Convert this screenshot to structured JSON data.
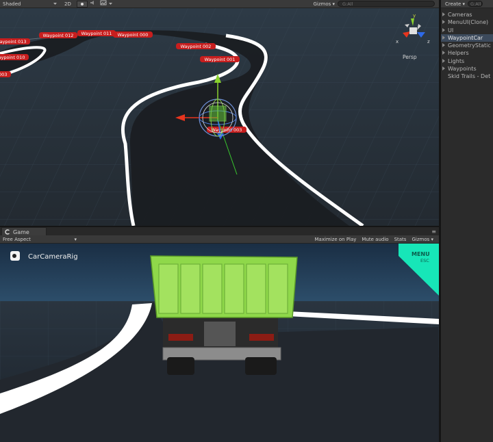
{
  "scene_toolbar": {
    "shading_mode": "Shaded",
    "mode_2d": "2D",
    "gizmos": "Gizmos",
    "search_placeholder": "G:All"
  },
  "scene": {
    "persp_label": "Persp",
    "axis": {
      "y": "y",
      "x": "x",
      "z": "z"
    },
    "waypoint_labels": [
      "Waypoint 013",
      "Waypoint 012",
      "Waypoint 011",
      "Waypoint 000",
      "Waypoint 010",
      "Waypoint 003",
      "Waypoint 002",
      "Waypoint 001",
      "Waypoint 003",
      "Waypoint 002"
    ]
  },
  "hierarchy": {
    "create_label": "Create",
    "search_placeholder": "G:All",
    "items": [
      {
        "label": "Cameras",
        "expandable": true
      },
      {
        "label": "MenuUI(Clone)",
        "expandable": true
      },
      {
        "label": "UI",
        "expandable": true
      },
      {
        "label": "WaypointCar",
        "expandable": true,
        "selected": true
      },
      {
        "label": "GeometryStatic",
        "expandable": true
      },
      {
        "label": "Helpers",
        "expandable": true
      },
      {
        "label": "Lights",
        "expandable": true
      },
      {
        "label": "Waypoints",
        "expandable": true
      },
      {
        "label": "Skid Trails - Det",
        "expandable": false
      }
    ]
  },
  "game": {
    "tab_label": "Game",
    "aspect": "Free Aspect",
    "maximize_on_play": "Maximize on Play",
    "mute_audio": "Mute audio",
    "stats": "Stats",
    "gizmos": "Gizmos",
    "camera_rig_label": "CarCameraRig",
    "menu_label": "MENU",
    "menu_sub": "ESC"
  },
  "colors": {
    "waypoint_label_bg": "#c81e1e",
    "menu_accent": "#17e6b8",
    "truck_green": "#8fd84a",
    "gizmo_x": "#e8351e",
    "gizmo_y": "#8ad22e",
    "gizmo_z": "#2e6ae8"
  }
}
